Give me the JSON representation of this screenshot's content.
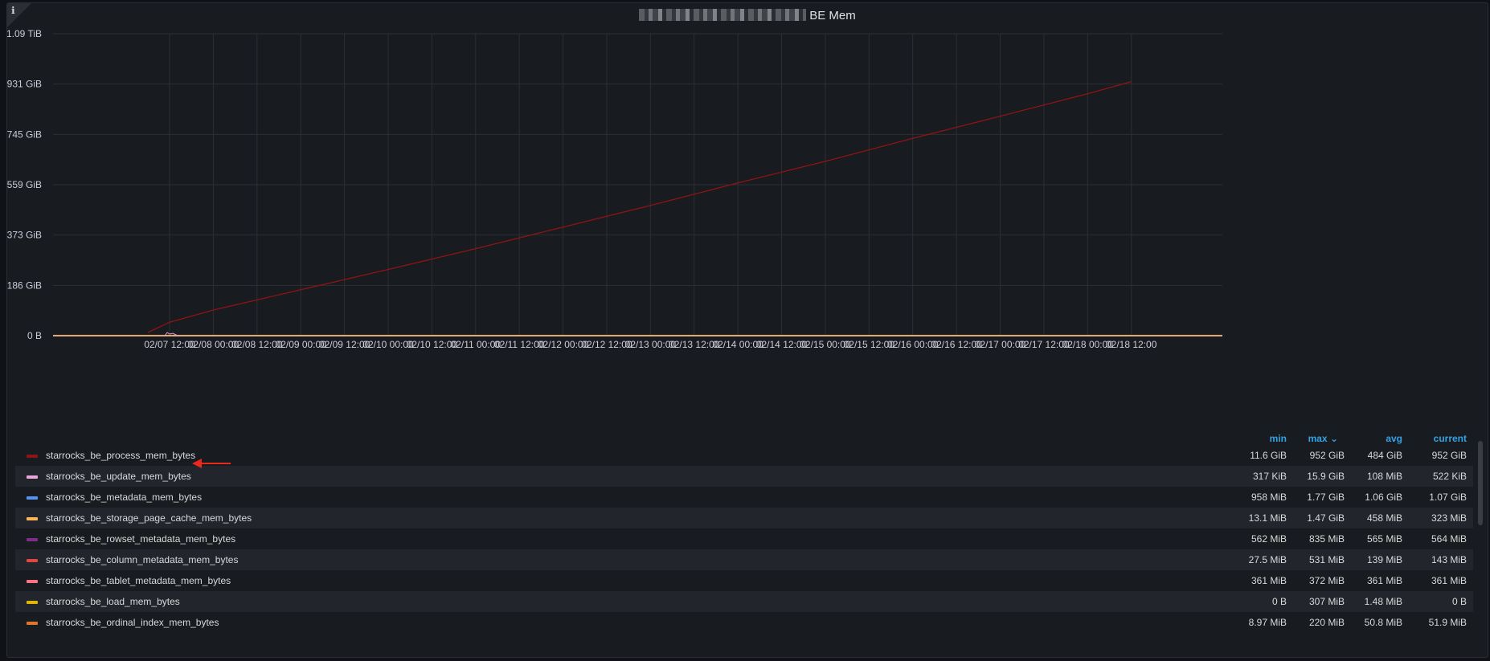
{
  "panel": {
    "title_suffix": "BE Mem",
    "info_icon": "ℹ"
  },
  "chart_data": {
    "type": "line",
    "title": "BE Mem",
    "y_ticks": [
      "1.09 TiB",
      "931 GiB",
      "745 GiB",
      "559 GiB",
      "373 GiB",
      "186 GiB",
      "0 B"
    ],
    "x_ticks": [
      "02/07 12:00",
      "02/08 00:00",
      "02/08 12:00",
      "02/09 00:00",
      "02/09 12:00",
      "02/10 00:00",
      "02/10 12:00",
      "02/11 00:00",
      "02/11 12:00",
      "02/12 00:00",
      "02/12 12:00",
      "02/13 00:00",
      "02/13 12:00",
      "02/14 00:00",
      "02/14 12:00",
      "02/15 00:00",
      "02/15 12:00",
      "02/16 00:00",
      "02/16 12:00",
      "02/17 00:00",
      "02/17 12:00",
      "02/18 00:00",
      "02/18 12:00"
    ],
    "y_range_gib": [
      0,
      1117
    ],
    "grid": true,
    "series": [
      {
        "name": "starrocks_be_process_mem_bytes",
        "color": "#8f1414",
        "x": [
          "02/07 06:00",
          "02/07 12:00",
          "02/08 00:00",
          "02/09 00:00",
          "02/10 00:00",
          "02/11 00:00",
          "02/12 00:00",
          "02/13 00:00",
          "02/14 00:00",
          "02/15 00:00",
          "02/16 00:00",
          "02/17 00:00",
          "02/18 00:00",
          "02/18 12:00"
        ],
        "y_gib": [
          12,
          50,
          95,
          170,
          245,
          322,
          402,
          482,
          565,
          645,
          730,
          812,
          895,
          940
        ]
      },
      {
        "name": "starrocks_be_update_mem_bytes",
        "color": "#e8a6dc",
        "y_gib_const": 0.0005
      },
      {
        "name": "starrocks_be_metadata_mem_bytes",
        "color": "#5794f2",
        "y_gib_const": 1.07
      },
      {
        "name": "starrocks_be_storage_page_cache_mem_bytes",
        "color": "#ffb357",
        "y_gib_const": 0.3
      }
    ]
  },
  "legend": {
    "headers": {
      "min": "min",
      "max": "max",
      "avg": "avg",
      "current": "current",
      "sort_indicator": "⌄"
    },
    "rows": [
      {
        "name": "starrocks_be_process_mem_bytes",
        "color": "#8f1414",
        "min": "11.6 GiB",
        "max": "952 GiB",
        "avg": "484 GiB",
        "current": "952 GiB"
      },
      {
        "name": "starrocks_be_update_mem_bytes",
        "color": "#e8a6dc",
        "min": "317 KiB",
        "max": "15.9 GiB",
        "avg": "108 MiB",
        "current": "522 KiB"
      },
      {
        "name": "starrocks_be_metadata_mem_bytes",
        "color": "#5794f2",
        "min": "958 MiB",
        "max": "1.77 GiB",
        "avg": "1.06 GiB",
        "current": "1.07 GiB"
      },
      {
        "name": "starrocks_be_storage_page_cache_mem_bytes",
        "color": "#ffb357",
        "min": "13.1 MiB",
        "max": "1.47 GiB",
        "avg": "458 MiB",
        "current": "323 MiB"
      },
      {
        "name": "starrocks_be_rowset_metadata_mem_bytes",
        "color": "#7c2e8a",
        "min": "562 MiB",
        "max": "835 MiB",
        "avg": "565 MiB",
        "current": "564 MiB"
      },
      {
        "name": "starrocks_be_column_metadata_mem_bytes",
        "color": "#e0483f",
        "min": "27.5 MiB",
        "max": "531 MiB",
        "avg": "139 MiB",
        "current": "143 MiB"
      },
      {
        "name": "starrocks_be_tablet_metadata_mem_bytes",
        "color": "#ff7383",
        "min": "361 MiB",
        "max": "372 MiB",
        "avg": "361 MiB",
        "current": "361 MiB"
      },
      {
        "name": "starrocks_be_load_mem_bytes",
        "color": "#e0b400",
        "min": "0 B",
        "max": "307 MiB",
        "avg": "1.48 MiB",
        "current": "0 B"
      },
      {
        "name": "starrocks_be_ordinal_index_mem_bytes",
        "color": "#e0752d",
        "min": "8.97 MiB",
        "max": "220 MiB",
        "avg": "50.8 MiB",
        "current": "51.9 MiB"
      }
    ]
  },
  "annotation": {
    "arrow_color": "#e8291c"
  }
}
